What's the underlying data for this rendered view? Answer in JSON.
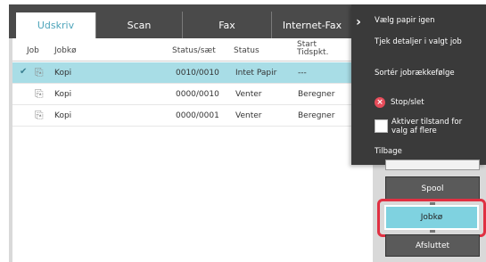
{
  "tabs": [
    {
      "label": "Udskriv",
      "active": true
    },
    {
      "label": "Scan"
    },
    {
      "label": "Fax"
    },
    {
      "label": "Internet-Fax"
    }
  ],
  "table": {
    "headers": {
      "job": "Job",
      "queue": "Jobkø",
      "status_set": "Status/sæt",
      "status": "Status",
      "start": "Start Tidspkt."
    },
    "rows": [
      {
        "queue": "Kopi",
        "status_set": "0010/0010",
        "status": "Intet Papir",
        "start": "---",
        "selected": true
      },
      {
        "queue": "Kopi",
        "status_set": "0000/0010",
        "status": "Venter",
        "start": "Beregner"
      },
      {
        "queue": "Kopi",
        "status_set": "0000/0001",
        "status": "Venter",
        "start": "Beregner"
      }
    ]
  },
  "menu": {
    "items": [
      "Vælg papir igen",
      "Tjek detaljer i valgt job",
      "Sortér jobrækkefølge",
      "Stop/slet",
      "Aktiver tilstand for valg af flere",
      "Tilbage"
    ]
  },
  "buttons": {
    "spool": "Spool",
    "jobko": "Jobkø",
    "afsluttet": "Afsluttet"
  },
  "colors": {
    "accent": "#7fd2e0",
    "highlight": "#e03042",
    "selected_row": "#a8dde6"
  }
}
